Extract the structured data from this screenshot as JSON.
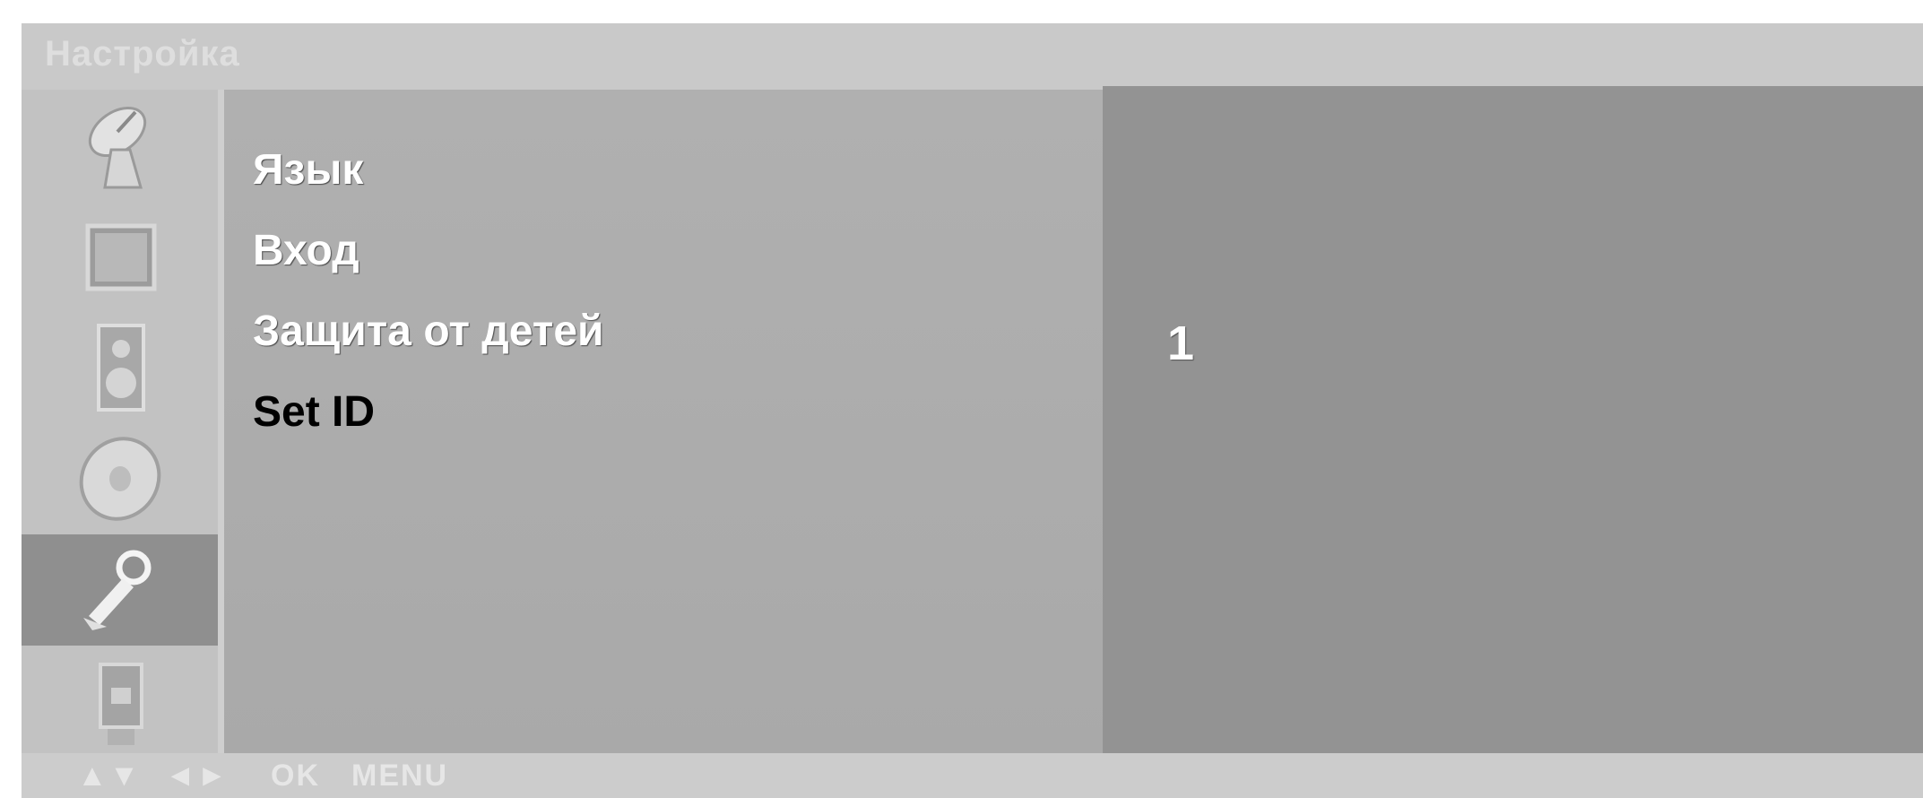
{
  "osd": {
    "title": "Настройка",
    "icons": [
      {
        "name": "satellite-dish-icon",
        "selected": false
      },
      {
        "name": "picture-icon",
        "selected": false
      },
      {
        "name": "speaker-icon",
        "selected": false
      },
      {
        "name": "disc-timer-icon",
        "selected": false
      },
      {
        "name": "wrench-icon",
        "selected": true
      },
      {
        "name": "input-device-icon",
        "selected": false
      }
    ],
    "menu_items": [
      {
        "label": "Язык"
      },
      {
        "label": "Вход"
      },
      {
        "label": "Защита от детей"
      },
      {
        "label": "Set ID",
        "active": true
      }
    ],
    "value": "1",
    "nav_hints": {
      "updown": "▲▼",
      "leftright": "◄►",
      "ok": "OK",
      "menu": "MENU"
    }
  }
}
